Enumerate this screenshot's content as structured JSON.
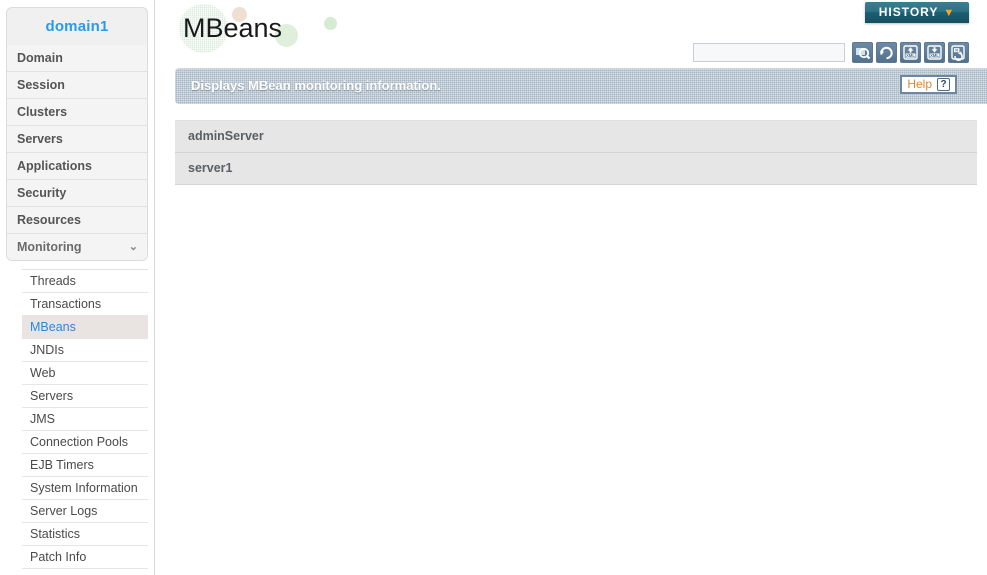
{
  "sidebar": {
    "domain_title": "domain1",
    "main_items": [
      {
        "label": "Domain"
      },
      {
        "label": "Session"
      },
      {
        "label": "Clusters"
      },
      {
        "label": "Servers"
      },
      {
        "label": "Applications"
      },
      {
        "label": "Security"
      },
      {
        "label": "Resources"
      },
      {
        "label": "Monitoring",
        "expanded": true,
        "caret": "⌄"
      }
    ],
    "sub_items": [
      {
        "label": "Threads"
      },
      {
        "label": "Transactions"
      },
      {
        "label": "MBeans",
        "active": true
      },
      {
        "label": "JNDIs"
      },
      {
        "label": "Web"
      },
      {
        "label": "Servers"
      },
      {
        "label": "JMS"
      },
      {
        "label": "Connection Pools"
      },
      {
        "label": "EJB Timers"
      },
      {
        "label": "System Information"
      },
      {
        "label": "Server Logs"
      },
      {
        "label": "Statistics"
      },
      {
        "label": "Patch Info"
      }
    ]
  },
  "header": {
    "page_title": "MBeans",
    "history_label": "HISTORY",
    "history_caret": "▼"
  },
  "toolbar": {
    "search_value": "",
    "search_placeholder": "",
    "icons": [
      {
        "name": "search-icon"
      },
      {
        "name": "reload-icon"
      },
      {
        "name": "xml-upload-icon"
      },
      {
        "name": "xml-download-icon"
      },
      {
        "name": "restart-icon"
      }
    ]
  },
  "banner": {
    "text": "Displays MBean monitoring information.",
    "help_label": "Help",
    "help_icon_glyph": "?"
  },
  "list": {
    "rows": [
      {
        "name": "adminServer"
      },
      {
        "name": "server1"
      }
    ]
  },
  "colors": {
    "accent_blue": "#279ceb",
    "history_teal": "#2d7285",
    "history_caret_orange": "#f5a623",
    "banner_gray": "#a8b7c6",
    "help_orange": "#e08a2e",
    "row_gray": "#e6e6e6",
    "active_item_bg": "#e9e4e2"
  }
}
